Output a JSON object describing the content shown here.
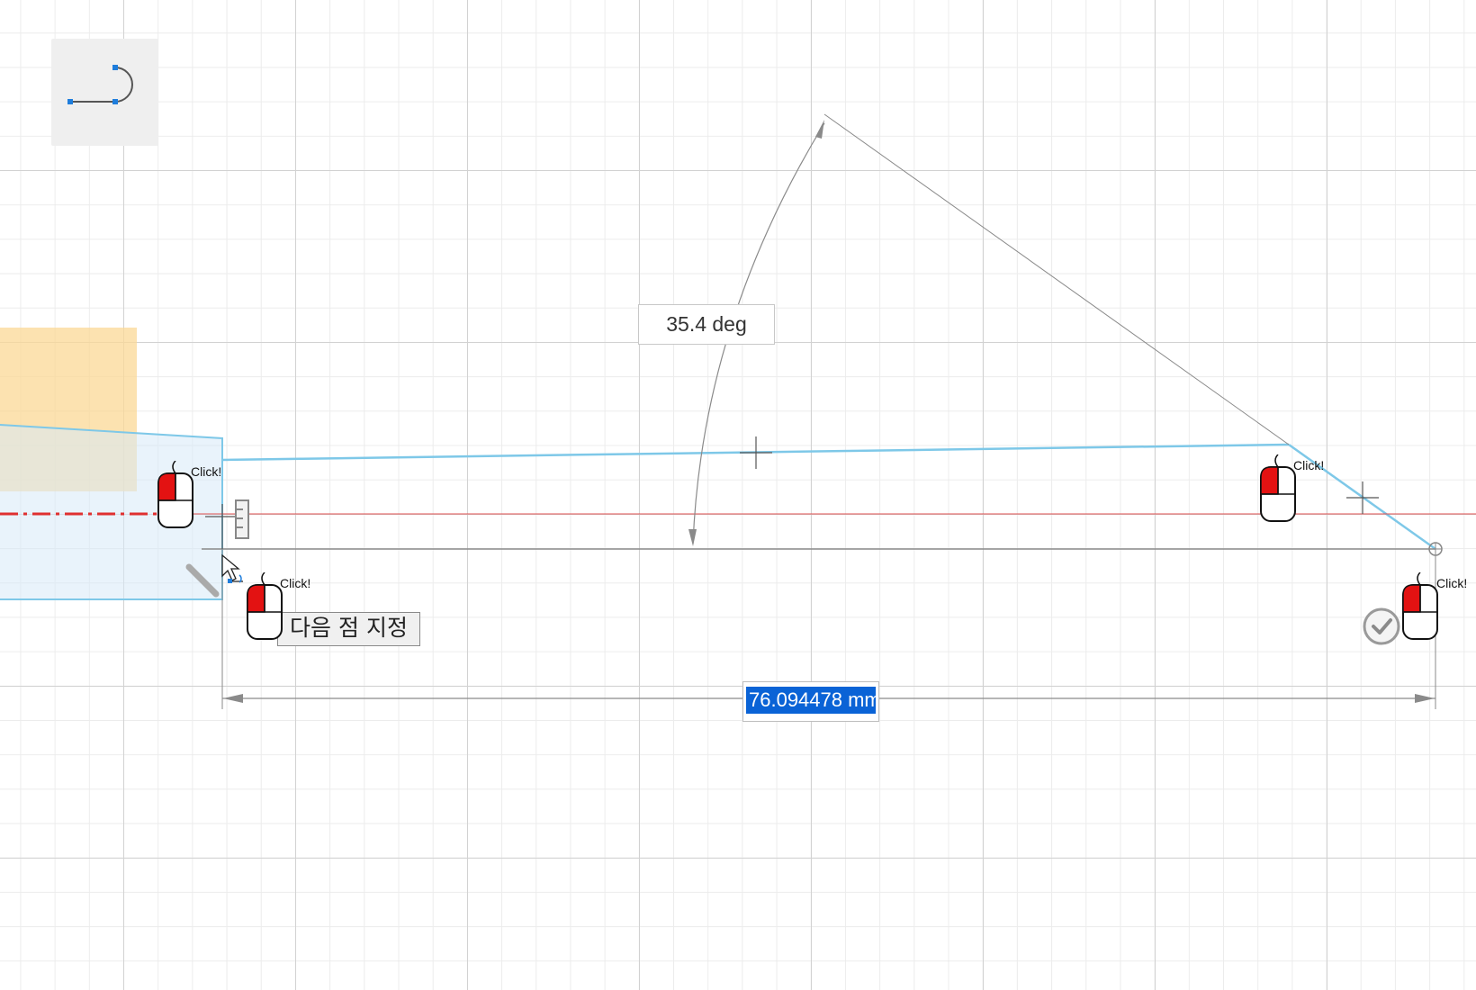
{
  "viewport": {
    "grid": "on",
    "colors": {
      "sketch_line": "#7ec8e8",
      "profile_fill": "#e6f2fb",
      "selection_box": "#fbd896",
      "axis_red": "#e03030",
      "dimension": "#8a8a8a"
    }
  },
  "tool_icon": {
    "name": "line-arc-tool-icon"
  },
  "dimensions": {
    "angle_value": "35.4 deg",
    "length_value": "76.094478 mm"
  },
  "tooltip": {
    "text": "다음 점 지정"
  },
  "mouse_badges": [
    {
      "id": "left",
      "label": "Click!"
    },
    {
      "id": "right",
      "label": "Click!"
    },
    {
      "id": "bottom-left",
      "label": "Click!"
    },
    {
      "id": "bottom-right",
      "label": "Click!"
    }
  ],
  "icons": {
    "confirm": "checkmark-circle-icon",
    "mouse": "mouse-left-click-icon",
    "cursor": "arrow-cursor-icon"
  }
}
